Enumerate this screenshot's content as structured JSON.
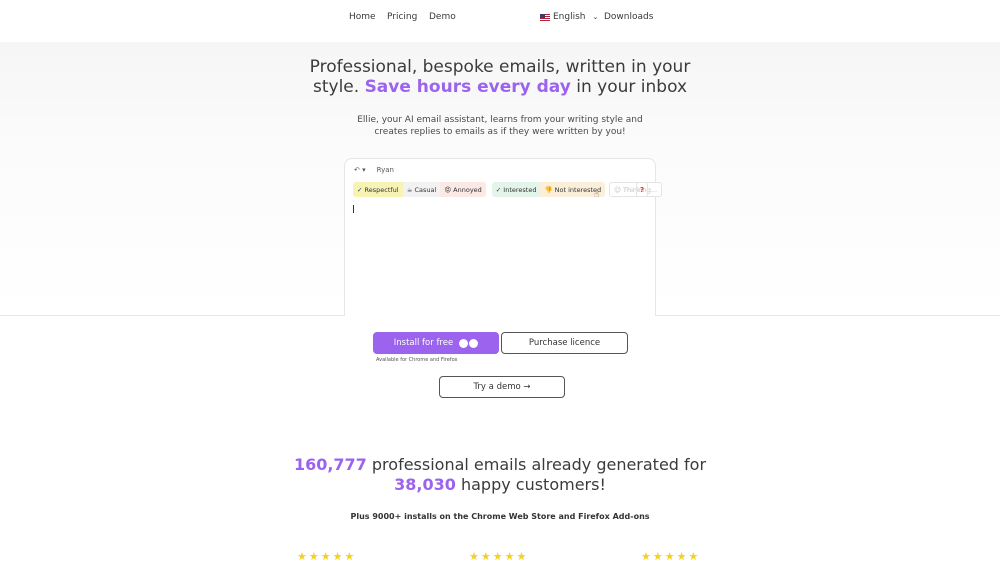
{
  "nav": {
    "home": "Home",
    "pricing": "Pricing",
    "demo": "Demo",
    "language": "English",
    "downloads": "Downloads"
  },
  "hero": {
    "title_part1": "Professional, bespoke emails, written in your style. ",
    "title_accent": "Save hours every day",
    "title_part2": " in your inbox",
    "subtitle": "Ellie, your AI email assistant, learns from your writing style and creates replies to emails as if they were written by you!",
    "accent_color": "#9b63ee"
  },
  "demo_card": {
    "reply_icon": "reply-icon",
    "recipient": "Ryan",
    "chips": {
      "respectful": "✓ Respectful",
      "casual": "☕ Casual",
      "annoyed": "😡 Annoyed",
      "interested": "✓ Interested",
      "not_interested": "👎 Not interested",
      "thinking": "☺ Thinking..."
    },
    "help": "?"
  },
  "cta": {
    "install": "Install for free",
    "purchase": "Purchase licence",
    "available": "Available for Chrome and Firefox",
    "demo": "Try a demo →"
  },
  "stats": {
    "emails_count": "160,777",
    "emails_text": " professional emails already generated for ",
    "customers_count": "38,030",
    "customers_text": " happy customers!",
    "installs": "Plus 9000+ installs on the Chrome Web Store and Firefox Add-ons"
  },
  "ratings": [
    {
      "stars": 5,
      "glyphs": "★★★★★"
    },
    {
      "stars": 5,
      "glyphs": "★★★★★"
    },
    {
      "stars": 5,
      "glyphs": "★★★★★"
    }
  ]
}
